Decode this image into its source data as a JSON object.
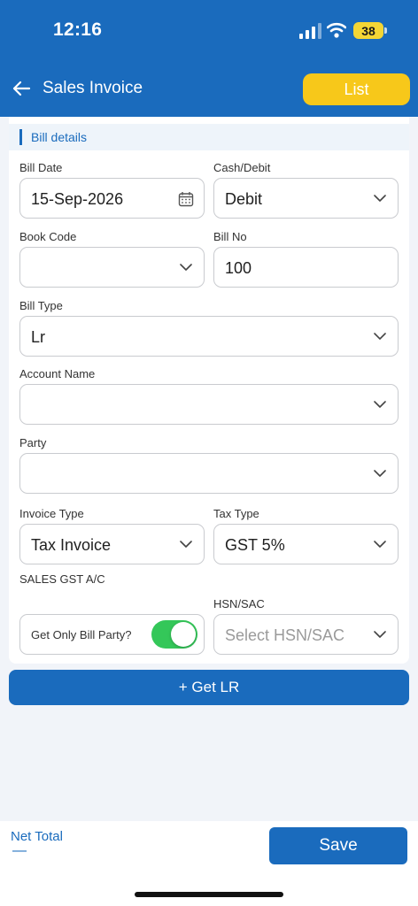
{
  "status_bar": {
    "time": "12:16",
    "battery": "38"
  },
  "app_bar": {
    "title": "Sales Invoice",
    "list_label": "List"
  },
  "section": {
    "title": "Bill details"
  },
  "form": {
    "bill_date": {
      "label": "Bill Date",
      "value": "15-Sep-2026"
    },
    "cash_debit": {
      "label": "Cash/Debit",
      "value": "Debit"
    },
    "book_code": {
      "label": "Book Code",
      "value": ""
    },
    "bill_no": {
      "label": "Bill No",
      "value": "100"
    },
    "bill_type": {
      "label": "Bill Type",
      "value": "Lr"
    },
    "account_name": {
      "label": "Account Name",
      "value": ""
    },
    "party": {
      "label": "Party",
      "value": ""
    },
    "invoice_type": {
      "label": "Invoice Type",
      "value": "Tax Invoice"
    },
    "tax_type": {
      "label": "Tax Type",
      "value": "GST 5%"
    },
    "sales_gst": {
      "label": "SALES GST A/C"
    },
    "hsn_sac": {
      "label": "HSN/SAC",
      "placeholder": "Select HSN/SAC"
    },
    "get_only_bill_party": {
      "label": "Get Only Bill Party?",
      "on": true
    }
  },
  "actions": {
    "get_lr": "+ Get LR",
    "save": "Save"
  },
  "footer": {
    "net_total_label": "Net Total",
    "net_total_value": "—"
  },
  "colors": {
    "primary": "#1a6bbd",
    "accent": "#f7c81a",
    "toggle_on": "#34c759"
  }
}
